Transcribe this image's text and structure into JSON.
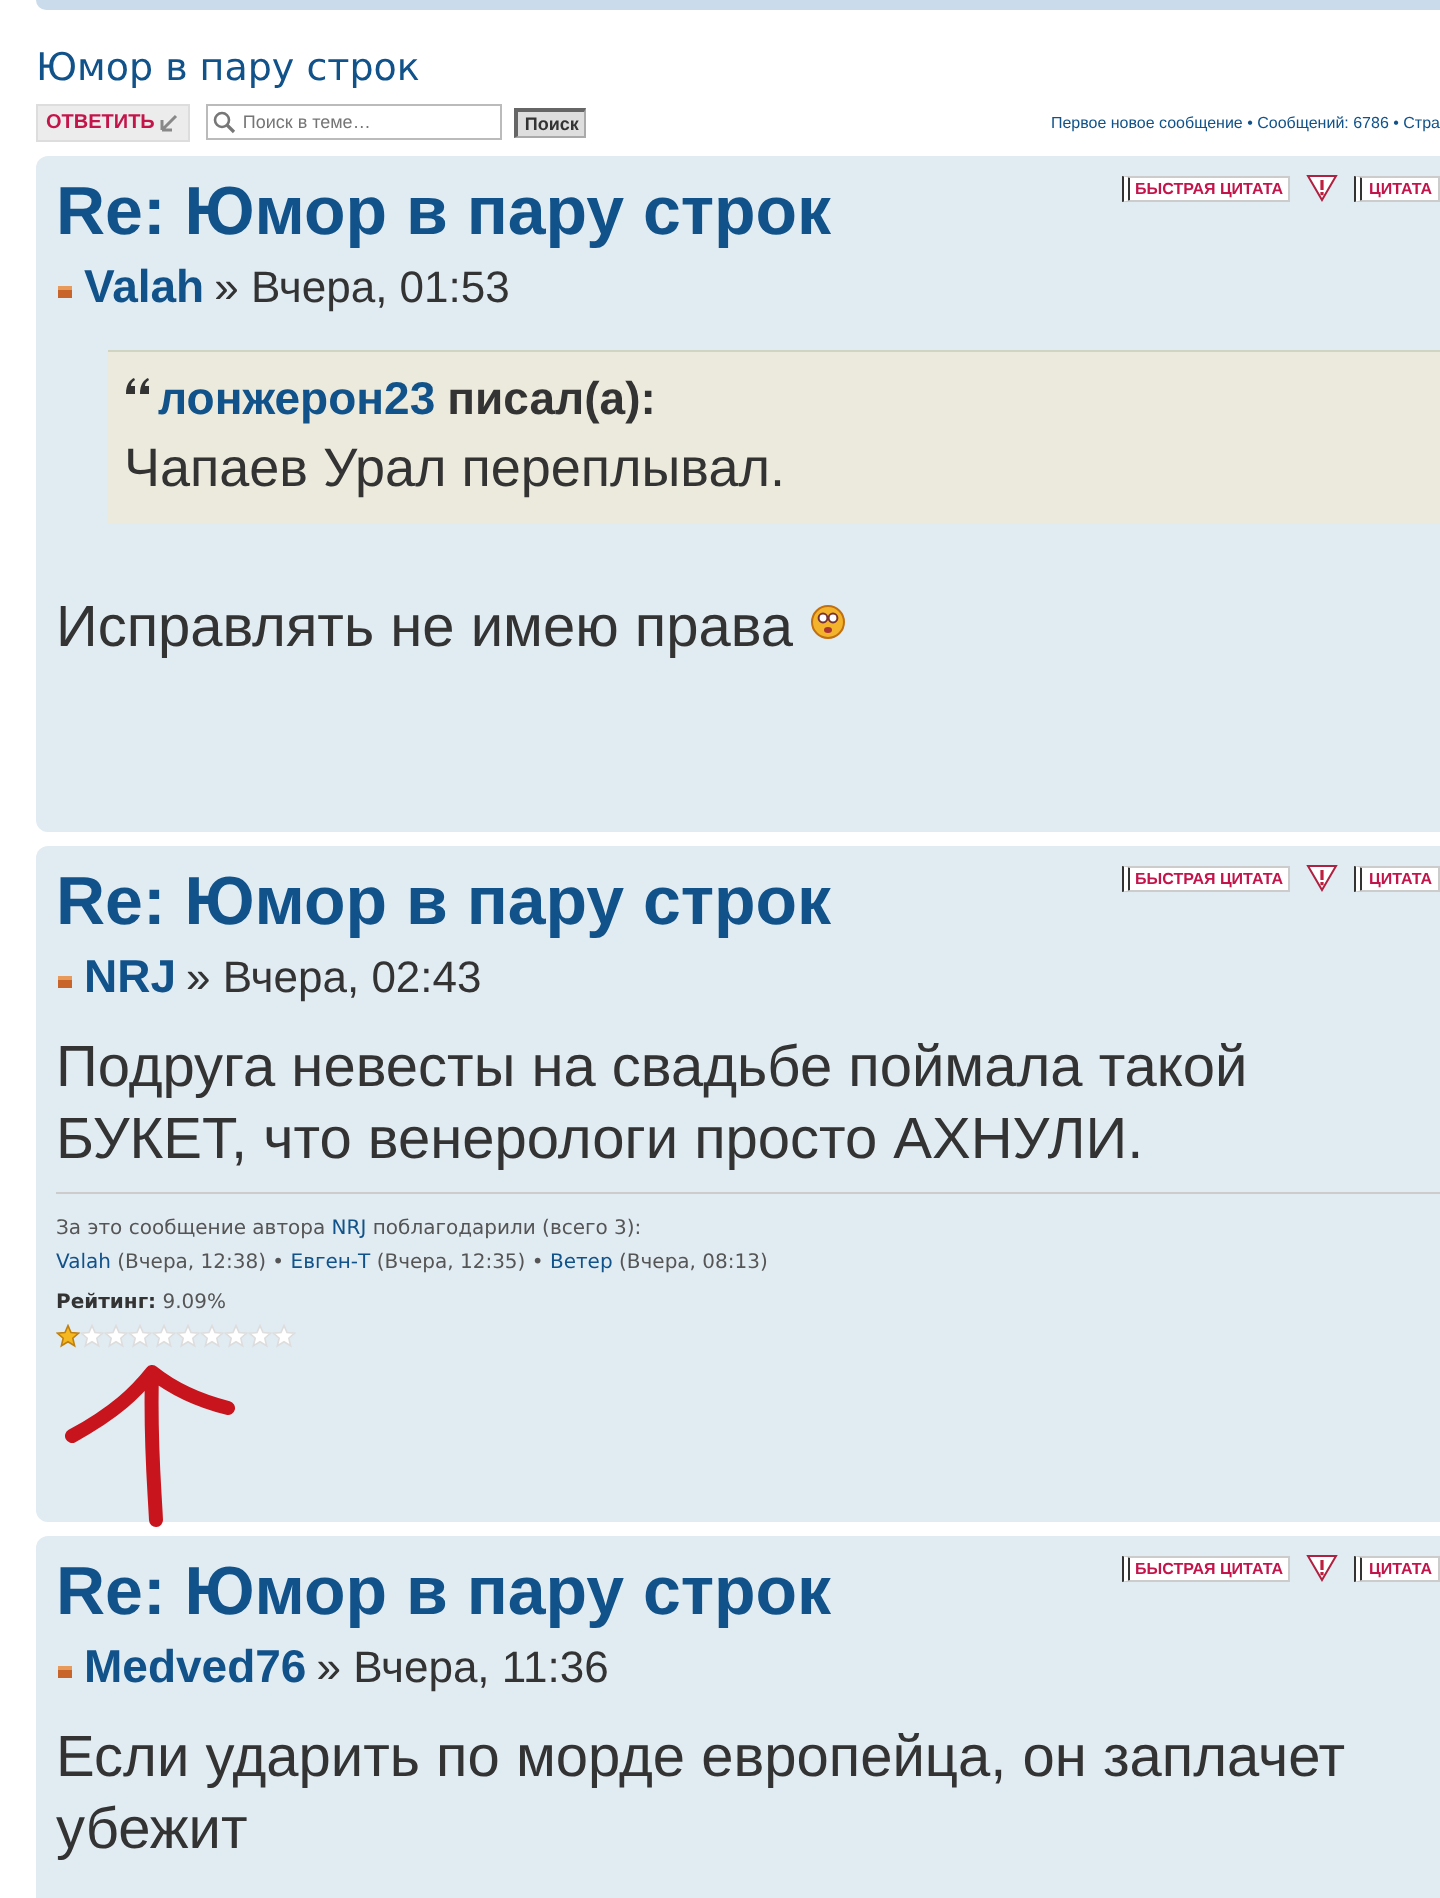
{
  "topic": {
    "title": "Юмор в пару строк",
    "reply_button": "ОТВЕТИТЬ",
    "search_placeholder": "Поиск в теме…",
    "search_button": "Поиск",
    "info": "Первое новое сообщение • Сообщений: 6786 • Стра"
  },
  "posts": [
    {
      "title": "Re: Юмор в пару строк",
      "quick_quote": "БЫСТРАЯ ЦИТАТА",
      "quote_button": "ЦИТАТА",
      "author": "Valah",
      "time": "» Вчера, 01:53",
      "quote": {
        "author": "лонжерон23",
        "said": "писал(а):",
        "text": "Чапаев Урал переплывал."
      },
      "body": "Исправлять не имею права",
      "emoticon": true
    },
    {
      "title": "Re: Юмор в пару строк",
      "quick_quote": "БЫСТРАЯ ЦИТАТА",
      "quote_button": "ЦИТАТА",
      "author": "NRJ",
      "time": "» Вчера, 02:43",
      "body": "Подруга невесты на свадьбе поймала такой\nБУКЕТ, что венерологи просто АХНУЛИ.",
      "thanks": {
        "prefix": "За это сообщение автора",
        "author": "NRJ",
        "suffix": "поблагодарили (всего 3):",
        "users": [
          {
            "name": "Valah",
            "time": "(Вчера, 12:38) •"
          },
          {
            "name": "Евген-Т",
            "time": "(Вчера, 12:35) •"
          },
          {
            "name": "Ветер",
            "time": "(Вчера, 08:13)"
          }
        ]
      },
      "rating": "Рейтинг: 9.09%",
      "stars": 1
    },
    {
      "title": "Re: Юмор в пару строк",
      "quick_quote": "БЫСТРАЯ ЦИТАТА",
      "quote_button": "ЦИТАТА",
      "author": "Medved76",
      "time": "» Вчера, 11:36",
      "body": "Если ударить по морде европейца, он заплачет\nубежит"
    }
  ]
}
